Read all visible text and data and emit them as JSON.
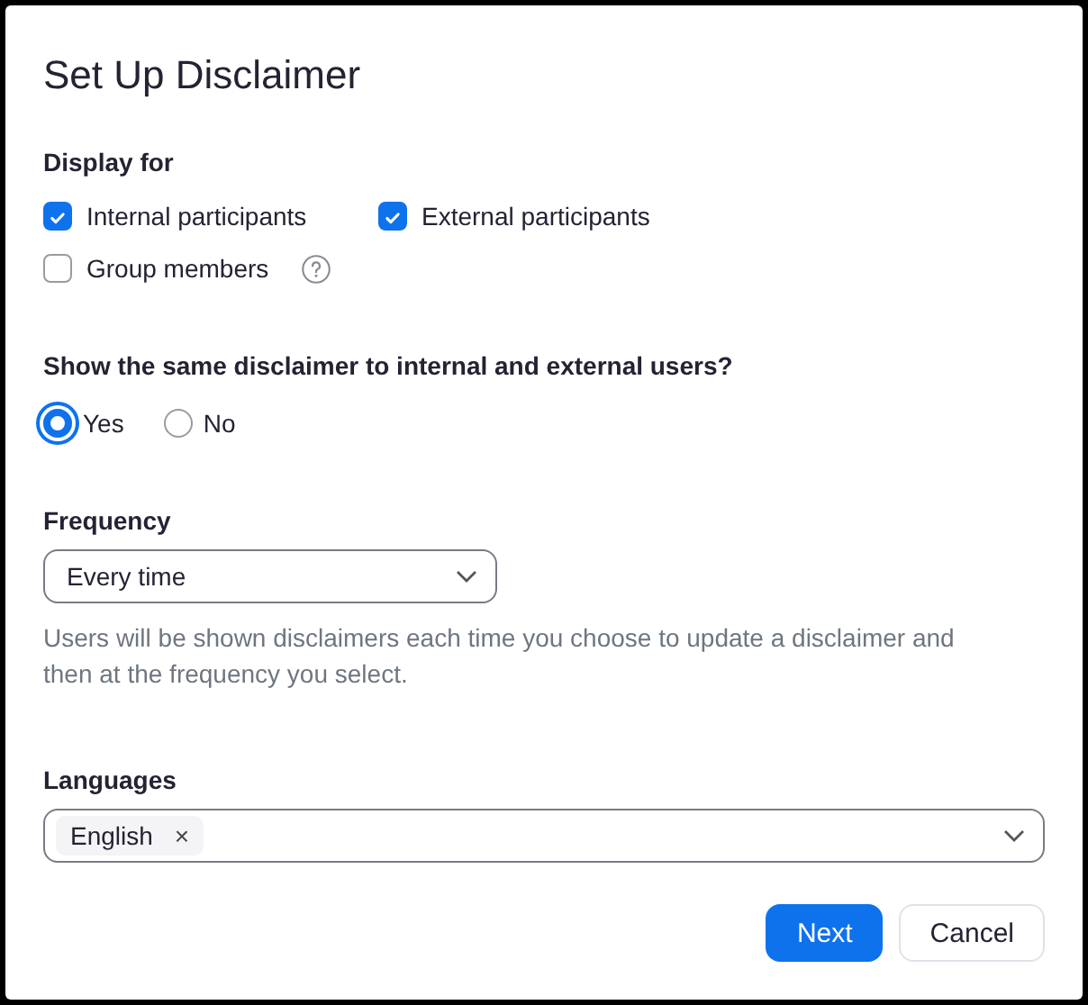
{
  "dialog": {
    "title": "Set Up Disclaimer"
  },
  "display_for": {
    "label": "Display for",
    "options": [
      {
        "label": "Internal participants",
        "checked": true,
        "help": false
      },
      {
        "label": "External participants",
        "checked": true,
        "help": false
      },
      {
        "label": "Group members",
        "checked": false,
        "help": true
      }
    ]
  },
  "same_disclaimer": {
    "label": "Show the same disclaimer to internal and external users?",
    "options": [
      {
        "label": "Yes",
        "selected": true
      },
      {
        "label": "No",
        "selected": false
      }
    ]
  },
  "frequency": {
    "label": "Frequency",
    "value": "Every time",
    "hint": "Users will be shown disclaimers each time you choose to update a disclaimer and then at the frequency you select."
  },
  "languages": {
    "label": "Languages",
    "tags": [
      {
        "label": "English",
        "remove": "×"
      }
    ]
  },
  "buttons": [
    {
      "label": "Next",
      "kind": "primary"
    },
    {
      "label": "Cancel",
      "kind": "secondary"
    }
  ]
}
